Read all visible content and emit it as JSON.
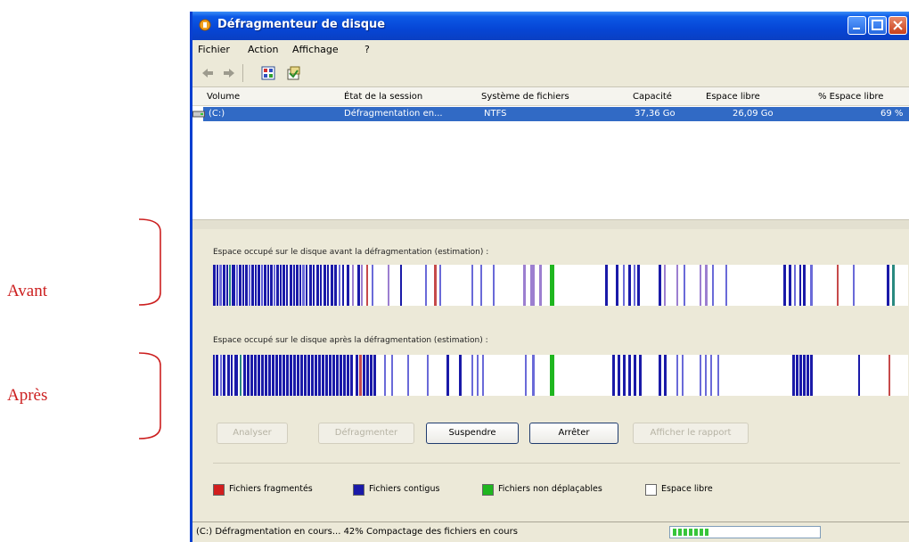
{
  "annotations": {
    "before": "Avant",
    "after": "Après"
  },
  "window": {
    "title": "Défragmenteur de disque",
    "menu": [
      "Fichier",
      "Action",
      "Affichage",
      "?"
    ],
    "icons": [
      "back-arrow-icon",
      "forward-arrow-icon",
      "view-icon",
      "properties-icon"
    ]
  },
  "volumes": {
    "columns": [
      "Volume",
      "État de la session",
      "Système de fichiers",
      "Capacité",
      "Espace libre",
      "% Espace libre"
    ],
    "rows": [
      {
        "volume": "(C:)",
        "status": "Défragmentation en...",
        "fs": "NTFS",
        "capacity": "37,36 Go",
        "free": "26,09 Go",
        "pct": "69 %"
      }
    ]
  },
  "analysis": {
    "before_label": "Espace occupé sur le disque avant la défragmentation (estimation) :",
    "after_label": "Espace occupé sur le disque après la défragmentation (estimation) :"
  },
  "buttons": {
    "analyze": "Analyser",
    "defragment": "Défragmenter",
    "pause": "Suspendre",
    "stop": "Arrêter",
    "report": "Afficher le rapport"
  },
  "legend": {
    "fragmented": "Fichiers fragmentés",
    "contiguous": "Fichiers contigus",
    "unmovable": "Fichiers non déplaçables",
    "free": "Espace libre",
    "colors": {
      "fragmented": "#d21e1e",
      "contiguous": "#1a1aa8",
      "unmovable": "#1fb61f",
      "free": "#ffffff"
    }
  },
  "status": {
    "text": "(C:) Défragmentation en cours... 42% Compactage des fichiers en cours",
    "progress": 0.42
  }
}
